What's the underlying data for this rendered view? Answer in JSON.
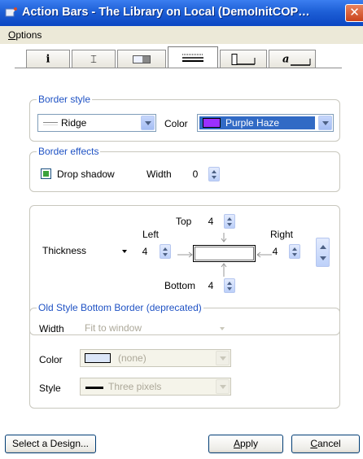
{
  "window": {
    "title": "Action Bars - The Library on Local (DemoInitCOP…",
    "close_glyph": "✕"
  },
  "menu": {
    "options_first": "O",
    "options_rest": "ptions"
  },
  "tabs": [
    {
      "glyph": "i",
      "icon": "info-icon"
    },
    {
      "glyph": "⌶",
      "icon": "height-icon"
    },
    {
      "glyph": "",
      "icon": "fill-icon"
    },
    {
      "glyph": "",
      "icon": "border-icon",
      "active": true
    },
    {
      "glyph": "",
      "icon": "bottom-icon"
    },
    {
      "glyph": "a",
      "icon": "text-icon"
    }
  ],
  "border_style": {
    "legend": "Border style",
    "style_value": "Ridge",
    "color_label": "Color",
    "color_value": "Purple Haze",
    "color_hex": "#9b30ff"
  },
  "border_effects": {
    "legend": "Border effects",
    "drop_shadow_label": "Drop shadow",
    "width_label": "Width",
    "width_value": "0"
  },
  "thickness": {
    "mode_value": "Thickness",
    "top_label": "Top",
    "top_value": "4",
    "left_label": "Left",
    "left_value": "4",
    "right_label": "Right",
    "right_value": "4",
    "bottom_label": "Bottom",
    "bottom_value": "4"
  },
  "old_border": {
    "legend": "Old Style Bottom Border (deprecated)",
    "width_label": "Width",
    "width_value": "Fit to window",
    "color_label": "Color",
    "color_value": "(none)",
    "style_label": "Style",
    "style_value": "Three pixels"
  },
  "buttons": {
    "select_design": "Select a Design...",
    "apply_first": "A",
    "apply_rest": "pply",
    "cancel_first": "C",
    "cancel_rest": "ancel"
  }
}
